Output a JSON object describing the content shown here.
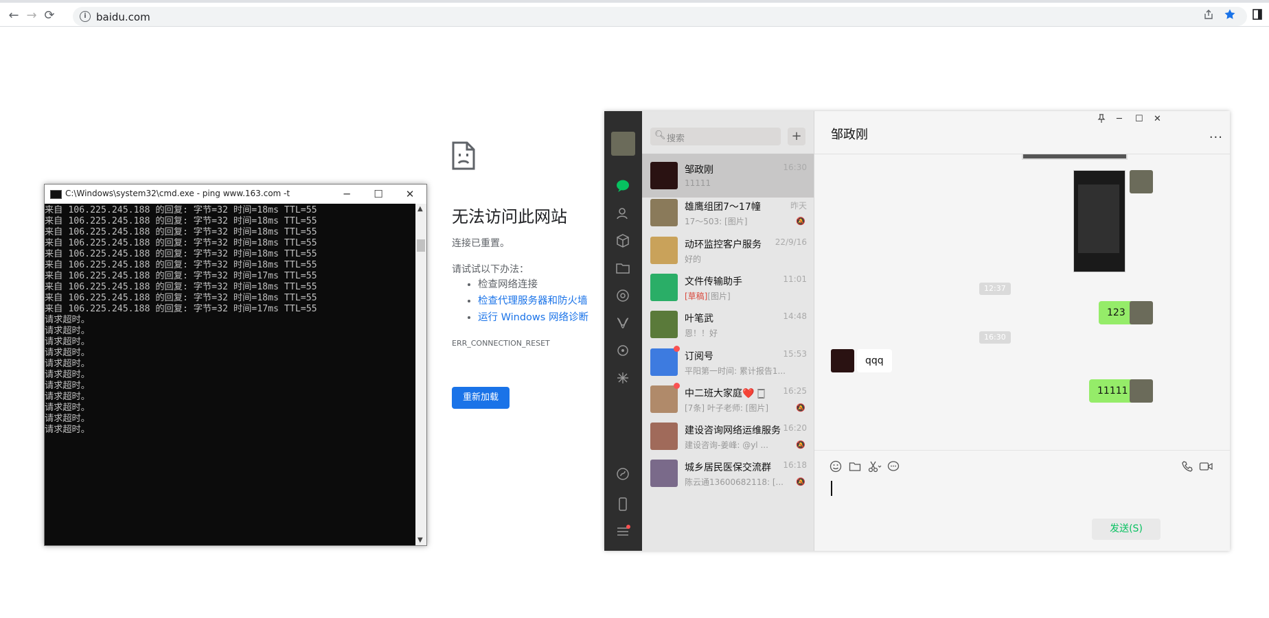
{
  "browser": {
    "url": "baidu.com",
    "nav": {
      "back": "←",
      "forward": "→",
      "reload": "⟳"
    },
    "info_glyph": "i",
    "star_color": "#1a73e8"
  },
  "error_page": {
    "title": "无法访问此网站",
    "subtitle": "连接已重置。",
    "try_label": "请试试以下办法：",
    "suggestions": [
      "检查网络连接",
      "检查代理服务器和防火墙",
      "运行 Windows 网络诊断"
    ],
    "code": "ERR_CONNECTION_RESET",
    "reload_button": "重新加载"
  },
  "cmd": {
    "title": "C:\\Windows\\system32\\cmd.exe - ping  www.163.com -t",
    "min": "─",
    "max": "☐",
    "close": "✕",
    "lines": [
      "来自 106.225.245.188 的回复: 字节=32 时间=18ms TTL=55",
      "来自 106.225.245.188 的回复: 字节=32 时间=18ms TTL=55",
      "来自 106.225.245.188 的回复: 字节=32 时间=18ms TTL=55",
      "来自 106.225.245.188 的回复: 字节=32 时间=18ms TTL=55",
      "来自 106.225.245.188 的回复: 字节=32 时间=18ms TTL=55",
      "来自 106.225.245.188 的回复: 字节=32 时间=18ms TTL=55",
      "来自 106.225.245.188 的回复: 字节=32 时间=17ms TTL=55",
      "来自 106.225.245.188 的回复: 字节=32 时间=18ms TTL=55",
      "来自 106.225.245.188 的回复: 字节=32 时间=18ms TTL=55",
      "来自 106.225.245.188 的回复: 字节=32 时间=17ms TTL=55",
      "请求超时。",
      "请求超时。",
      "请求超时。",
      "请求超时。",
      "请求超时。",
      "请求超时。",
      "请求超时。",
      "请求超时。",
      "请求超时。",
      "请求超时。",
      "请求超时。"
    ]
  },
  "wechat": {
    "search_placeholder": "搜索",
    "plus": "+",
    "chats": [
      {
        "name": "邹政刚",
        "preview": "11111",
        "time": "16:30",
        "active": true,
        "muted": false,
        "dot": false,
        "avatar_color": "#2a1212"
      },
      {
        "name": "雄鹰组团7～17幢",
        "preview": "17～503: [图片]",
        "time": "昨天",
        "muted": true,
        "dot": false,
        "avatar_color": "#8a7a5a"
      },
      {
        "name": "动环监控客户服务",
        "preview": "好的",
        "time": "22/9/16",
        "muted": false,
        "dot": false,
        "avatar_color": "#c9a25a"
      },
      {
        "name": "文件传输助手",
        "draft": "[草稿]",
        "preview": "[图片]",
        "time": "11:01",
        "muted": false,
        "dot": false,
        "avatar_color": "#2aae67"
      },
      {
        "name": "叶笔武",
        "preview": "恩！！好",
        "time": "14:48",
        "muted": false,
        "dot": false,
        "avatar_color": "#5a7a3a"
      },
      {
        "name": "订阅号",
        "preview": "平阳第一时间: 累计报告1...",
        "time": "15:53",
        "muted": false,
        "dot": true,
        "avatar_color": "#3d7be0"
      },
      {
        "name": "中二班大家庭❤️ 🀆",
        "preview": "[7条] 叶子老师: [图片]",
        "time": "16:25",
        "muted": true,
        "dot": true,
        "avatar_color": "#b08a6a"
      },
      {
        "name": "建设咨询网络运维服务",
        "preview": "建设咨询-姜峰: @yl   ...",
        "time": "16:20",
        "muted": true,
        "dot": false,
        "avatar_color": "#a06a5a"
      },
      {
        "name": "城乡居民医保交流群",
        "preview": "陈云通13600682118: [...",
        "time": "16:18",
        "muted": true,
        "dot": false,
        "avatar_color": "#7a6a8a"
      }
    ],
    "mute_glyph": "🔕",
    "conversation": {
      "title": "邹政刚",
      "more": "···",
      "timestamps": [
        "12:37",
        "16:30"
      ],
      "messages": [
        {
          "from": "me",
          "text": "123"
        },
        {
          "from": "other",
          "text": "qqq"
        },
        {
          "from": "me",
          "text": "11111"
        }
      ],
      "send_button": "发送(S)"
    },
    "window_buttons": {
      "pin": "📌",
      "min": "─",
      "max": "☐",
      "close": "✕"
    },
    "colors": {
      "sidebar": "#2e2e2e",
      "bubble_me": "#95ec69",
      "accent": "#07c160"
    }
  }
}
